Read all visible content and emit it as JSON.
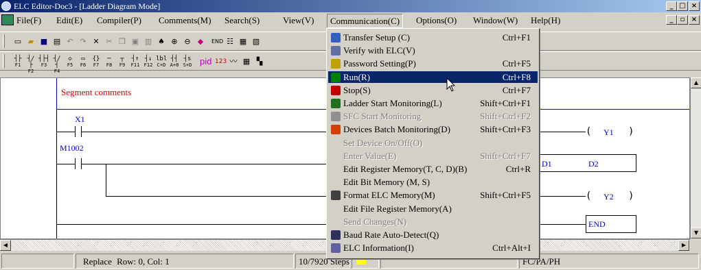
{
  "window": {
    "title": "ELC Editor-Doc3 - [Ladder Diagram Mode]"
  },
  "menubar": {
    "items": [
      "File(F)",
      "Edit(E)",
      "Compiler(P)",
      "Comments(M)",
      "Search(S)",
      "View(V)",
      "Communication(C)",
      "Options(O)",
      "Window(W)",
      "Help(H)"
    ],
    "active_index": 6
  },
  "toolbar2": {
    "pid_label": "pid"
  },
  "editor": {
    "segment_comment": "Segment comments",
    "contact1": "X1",
    "contact2": "M1002",
    "coil1": "Y1",
    "coil2": "Y2",
    "box_label1": "D1",
    "box_label2": "D2",
    "end_label": "END"
  },
  "statusbar": {
    "mode": "Replace",
    "position": "Row: 0, Col: 1",
    "steps": "10/7920 Steps",
    "model": "FC/PA/PH"
  },
  "communication_menu": {
    "items": [
      {
        "label": "Transfer Setup (C)",
        "shortcut": "Ctrl+F1",
        "enabled": true,
        "icon": "transfer-icon"
      },
      {
        "label": "Verify with ELC(V)",
        "shortcut": "",
        "enabled": true,
        "icon": "verify-icon"
      },
      {
        "label": "Password Setting(P)",
        "shortcut": "Ctrl+F5",
        "enabled": true,
        "icon": "key-icon"
      },
      {
        "label": "Run(R)",
        "shortcut": "Ctrl+F8",
        "enabled": true,
        "icon": "run-icon",
        "selected": true
      },
      {
        "label": "Stop(S)",
        "shortcut": "Ctrl+F7",
        "enabled": true,
        "icon": "stop-icon"
      },
      {
        "label": "Ladder Start Monitoring(L)",
        "shortcut": "Shift+Ctrl+F1",
        "enabled": true,
        "icon": "ladder-monitor-icon"
      },
      {
        "label": "SFC Start Monitoring",
        "shortcut": "Shift+Ctrl+F2",
        "enabled": false,
        "icon": "sfc-monitor-icon"
      },
      {
        "label": "Devices Batch Monitoring(D)",
        "shortcut": "Shift+Ctrl+F3",
        "enabled": true,
        "icon": "batch-monitor-icon"
      },
      {
        "label": "Set Device On/Off(O)",
        "shortcut": "",
        "enabled": false,
        "icon": ""
      },
      {
        "label": "Enter Value(E)",
        "shortcut": "Shift+Ctrl+F7",
        "enabled": false,
        "icon": ""
      },
      {
        "label": "Edit Register Memory(T, C, D)(B)",
        "shortcut": "Ctrl+R",
        "enabled": true,
        "icon": ""
      },
      {
        "label": "Edit Bit Memory (M, S)",
        "shortcut": "",
        "enabled": true,
        "icon": ""
      },
      {
        "label": "Format ELC Memory(M)",
        "shortcut": "Shift+Ctrl+F5",
        "enabled": true,
        "icon": "format-icon"
      },
      {
        "label": "Edit File Register Memory(A)",
        "shortcut": "",
        "enabled": true,
        "icon": ""
      },
      {
        "label": "Send Changes(N)",
        "shortcut": "",
        "enabled": false,
        "icon": ""
      },
      {
        "label": "Baud Rate Auto-Detect(Q)",
        "shortcut": "",
        "enabled": true,
        "icon": "baud-icon"
      },
      {
        "label": "ELC Information(I)",
        "shortcut": "Ctrl+Alt+I",
        "enabled": true,
        "icon": "info-icon"
      }
    ]
  },
  "colors": {
    "titlebar_start": "#0a246a",
    "titlebar_end": "#a6caf0",
    "menu_selection": "#0a246a",
    "segment_text": "#d00000",
    "ladder_labels": "#0000c0"
  }
}
